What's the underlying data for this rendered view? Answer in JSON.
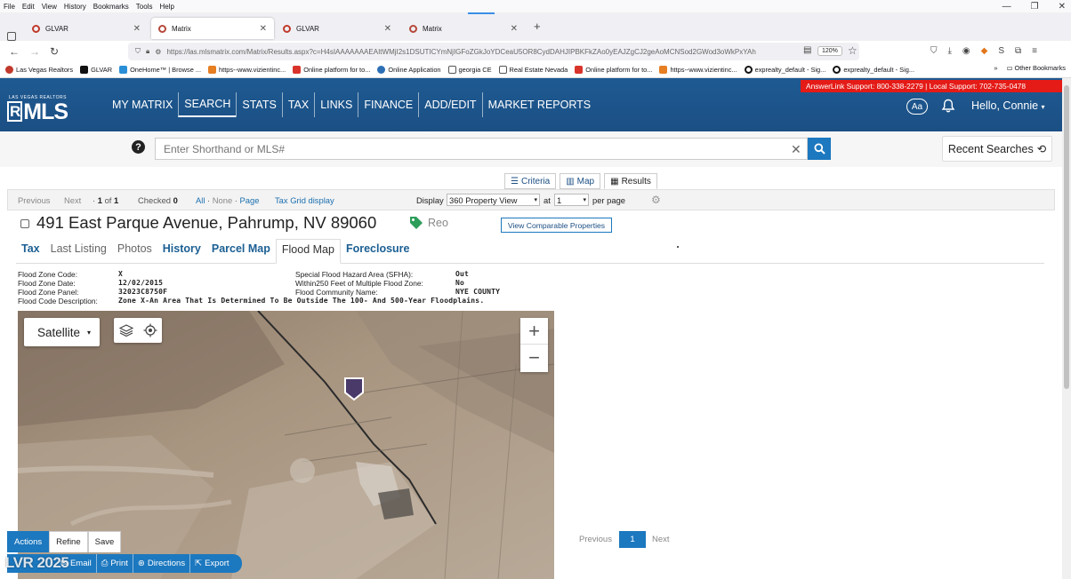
{
  "browser": {
    "menu": [
      "File",
      "Edit",
      "View",
      "History",
      "Bookmarks",
      "Tools",
      "Help"
    ],
    "tabs": [
      {
        "title": "GLVAR",
        "active": false
      },
      {
        "title": "Matrix",
        "active": true
      },
      {
        "title": "GLVAR",
        "active": false
      },
      {
        "title": "Matrix",
        "active": false
      }
    ],
    "url": "https://las.mlsmatrix.com/Matrix/Results.aspx?c=H4sIAAAAAAAEAItWMjI2s1DSUTICYmNjIGFoZGkJoYDCeaU5OR8CydDAHJIPBKFkZAo0yEAJZgCJ2geAoMCNSod2GWod3oWkPxYAh",
    "zoom_level": "120%",
    "bookmarks": [
      "Las Vegas Realtors",
      "GLVAR",
      "OneHome™ | Browse ...",
      "https--www.vizientinc...",
      "Online platform for to...",
      "Online Application",
      "georgia CE",
      "Real Estate Nevada",
      "Online platform for to...",
      "https--www.vizientinc...",
      "exprealty_default - Sig...",
      "exprealty_default - Sig..."
    ],
    "other_bookmarks": "Other Bookmarks"
  },
  "header": {
    "logo_small": "LAS VEGAS REALTORS",
    "logo": "MLS",
    "nav": [
      {
        "label": "MY MATRIX",
        "active": false
      },
      {
        "label": "SEARCH",
        "active": true
      },
      {
        "label": "STATS",
        "active": false
      },
      {
        "label": "TAX",
        "active": false
      },
      {
        "label": "LINKS",
        "active": false
      },
      {
        "label": "FINANCE",
        "active": false
      },
      {
        "label": "ADD/EDIT",
        "active": false
      },
      {
        "label": "MARKET REPORTS",
        "active": false
      }
    ],
    "support": "AnswerLink Support: 800-338-2279 | Local Support: 702-735-0478",
    "text_size_label": "Aa",
    "greeting": "Hello, Connie"
  },
  "search": {
    "placeholder": "Enter Shorthand or MLS#",
    "recent_label": "Recent Searches"
  },
  "view_tabs": [
    {
      "label": "Criteria",
      "icon": "sliders-icon",
      "active": false
    },
    {
      "label": "Map",
      "icon": "map-icon",
      "active": false
    },
    {
      "label": "Results",
      "icon": "grid-icon",
      "active": true
    }
  ],
  "results_bar": {
    "previous": "Previous",
    "next": "Next",
    "page_of": "1",
    "page_total": "1",
    "of_label": "of",
    "checked_label": "Checked",
    "checked_count": "0",
    "all": "All",
    "none": "None",
    "page": "Page",
    "tax_grid": "Tax Grid display",
    "display_label": "Display",
    "display_value": "360 Property View",
    "at_label": "at",
    "per_page_value": "1",
    "per_page_label": "per page"
  },
  "property": {
    "address": "491 East Parque Avenue, Pahrump, NV 89060",
    "status": "Reo",
    "status_color": "#2e9e5b",
    "compare_label": "View Comparable Properties",
    "tabs": [
      {
        "label": "Tax",
        "style": "link"
      },
      {
        "label": "Last Listing",
        "style": "plain"
      },
      {
        "label": "Photos",
        "style": "plain"
      },
      {
        "label": "History",
        "style": "link"
      },
      {
        "label": "Parcel Map",
        "style": "link"
      },
      {
        "label": "Flood Map",
        "style": "active"
      },
      {
        "label": "Foreclosure",
        "style": "link"
      }
    ]
  },
  "flood": {
    "zone_code_label": "Flood Zone Code:",
    "zone_code": "X",
    "zone_date_label": "Flood Zone Date:",
    "zone_date": "12/02/2015",
    "zone_panel_label": "Flood Zone Panel:",
    "zone_panel": "32023C8750F",
    "description_label": "Flood Code Description:",
    "description": "Zone X-An Area That Is Determined To Be Outside The 100- And 500-Year Floodplains.",
    "sfha_label": "Special Flood Hazard Area (SFHA):",
    "sfha": "Out",
    "within250_label": "Within250 Feet of Multiple Flood Zone:",
    "within250": "No",
    "community_label": "Flood Community Name:",
    "community": "NYE COUNTY"
  },
  "map": {
    "type_label": "Satellite",
    "zoom_in": "+",
    "zoom_out": "−"
  },
  "actions": {
    "tabs": [
      {
        "label": "Actions",
        "active": true
      },
      {
        "label": "Refine",
        "active": false
      },
      {
        "label": "Save",
        "active": false
      }
    ],
    "buttons": [
      {
        "label": "Email",
        "icon": "envelope-icon"
      },
      {
        "label": "Print",
        "icon": "printer-icon"
      },
      {
        "label": "Directions",
        "icon": "directions-icon"
      },
      {
        "label": "Export",
        "icon": "export-icon"
      }
    ],
    "watermark": "LVR 2025"
  },
  "pager": {
    "previous": "Previous",
    "current": "1",
    "next": "Next"
  },
  "colors": {
    "header_blue": "#1b4f84",
    "accent_blue": "#1c78bf",
    "support_red": "#e41b17",
    "pin_purple": "#4a3a6a"
  }
}
